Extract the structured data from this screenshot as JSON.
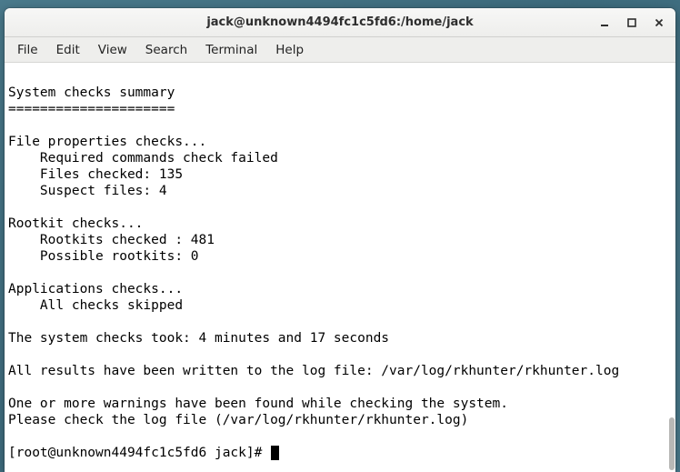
{
  "window": {
    "title": "jack@unknown4494fc1c5fd6:/home/jack"
  },
  "menu": {
    "items": [
      "File",
      "Edit",
      "View",
      "Search",
      "Terminal",
      "Help"
    ]
  },
  "terminal": {
    "lines": [
      "",
      "System checks summary",
      "=====================",
      "",
      "File properties checks...",
      "    Required commands check failed",
      "    Files checked: 135",
      "    Suspect files: 4",
      "",
      "Rootkit checks...",
      "    Rootkits checked : 481",
      "    Possible rootkits: 0",
      "",
      "Applications checks...",
      "    All checks skipped",
      "",
      "The system checks took: 4 minutes and 17 seconds",
      "",
      "All results have been written to the log file: /var/log/rkhunter/rkhunter.log",
      "",
      "One or more warnings have been found while checking the system.",
      "Please check the log file (/var/log/rkhunter/rkhunter.log)",
      ""
    ],
    "prompt": "[root@unknown4494fc1c5fd6 jack]# "
  }
}
